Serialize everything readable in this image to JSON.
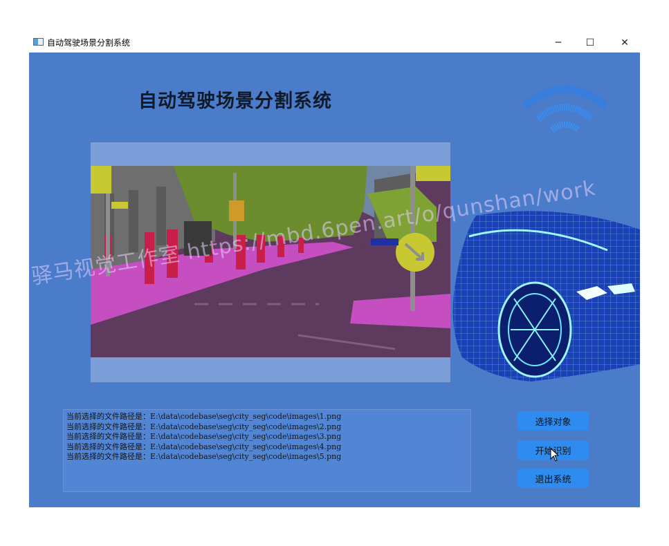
{
  "window": {
    "title": "自动驾驶场景分割系统",
    "minimize_glyph": "─",
    "maximize_glyph": "☐",
    "close_glyph": "✕"
  },
  "header": {
    "title": "自动驾驶场景分割系统"
  },
  "watermark": "驿马视觉工作室 https://mbd.6pen.art/o/qunshan/work",
  "log": {
    "lines": [
      "当前选择的文件路径是：E:\\data\\codebase\\seg\\city_seg\\code\\images\\1.png",
      "当前选择的文件路径是：E:\\data\\codebase\\seg\\city_seg\\code\\images\\2.png",
      "当前选择的文件路径是：E:\\data\\codebase\\seg\\city_seg\\code\\images\\3.png",
      "当前选择的文件路径是：E:\\data\\codebase\\seg\\city_seg\\code\\images\\4.png",
      "当前选择的文件路径是：E:\\data\\codebase\\seg\\city_seg\\code\\images\\5.png"
    ]
  },
  "buttons": {
    "select": "选择对象",
    "start": "开始识别",
    "exit": "退出系统"
  },
  "icons": {
    "app": "app-window-icon",
    "wifi": "wifi-signal-icon",
    "car": "wireframe-car-illustration",
    "cursor": "mouse-pointer-icon"
  },
  "colors": {
    "background": "#4a7cc9",
    "button": "#2e8cf0",
    "display_frame": "#7d9fd9"
  }
}
